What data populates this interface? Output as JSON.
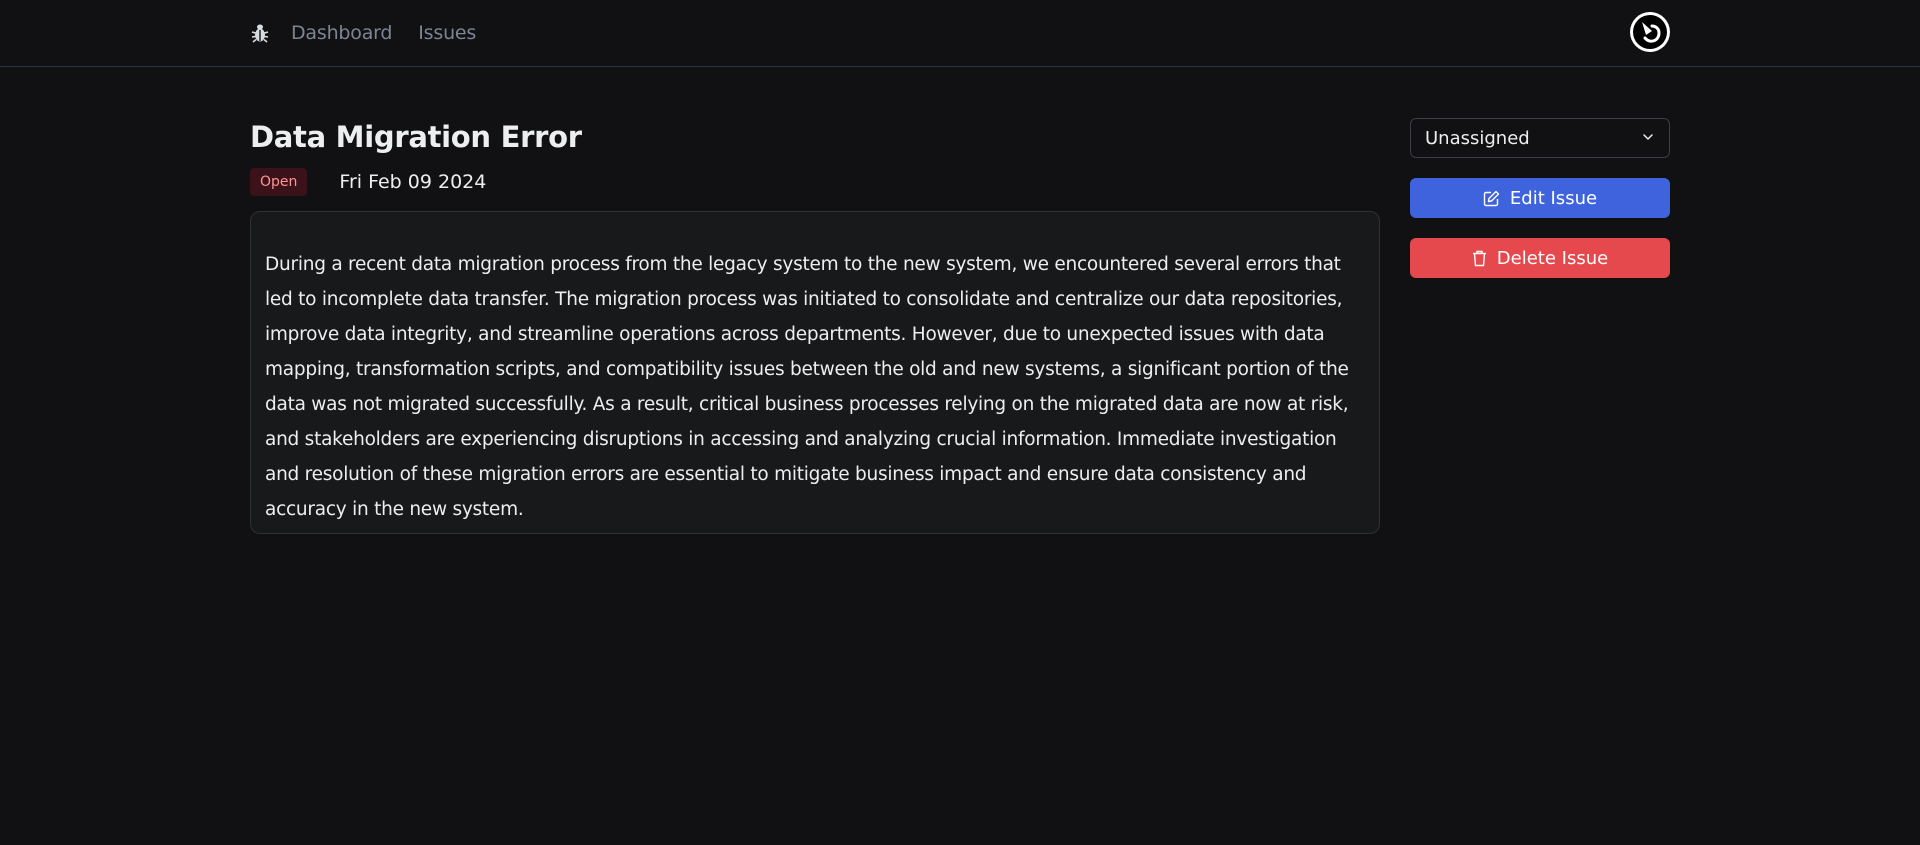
{
  "nav": {
    "links": [
      "Dashboard",
      "Issues"
    ],
    "logo_icon": "bug-icon",
    "avatar_icon": "user-avatar"
  },
  "issue": {
    "title": "Data Migration Error",
    "status": "Open",
    "date": "Fri Feb 09 2024",
    "description": "During a recent data migration process from the legacy system to the new system, we encountered several errors that led to incomplete data transfer. The migration process was initiated to consolidate and centralize our data repositories, improve data integrity, and streamline operations across departments. However, due to unexpected issues with data mapping, transformation scripts, and compatibility issues between the old and new systems, a significant portion of the data was not migrated successfully. As a result, critical business processes relying on the migrated data are now at risk, and stakeholders are experiencing disruptions in accessing and analyzing crucial information. Immediate investigation and resolution of these migration errors are essential to mitigate business impact and ensure data consistency and accuracy in the new system."
  },
  "actions": {
    "assignee": "Unassigned",
    "edit_label": "Edit Issue",
    "delete_label": "Delete Issue"
  },
  "colors": {
    "background": "#111113",
    "edit_button": "#3e63dd",
    "delete_button": "#e5484d",
    "status_badge_bg": "#3b121a",
    "status_badge_text": "#ff9592"
  }
}
